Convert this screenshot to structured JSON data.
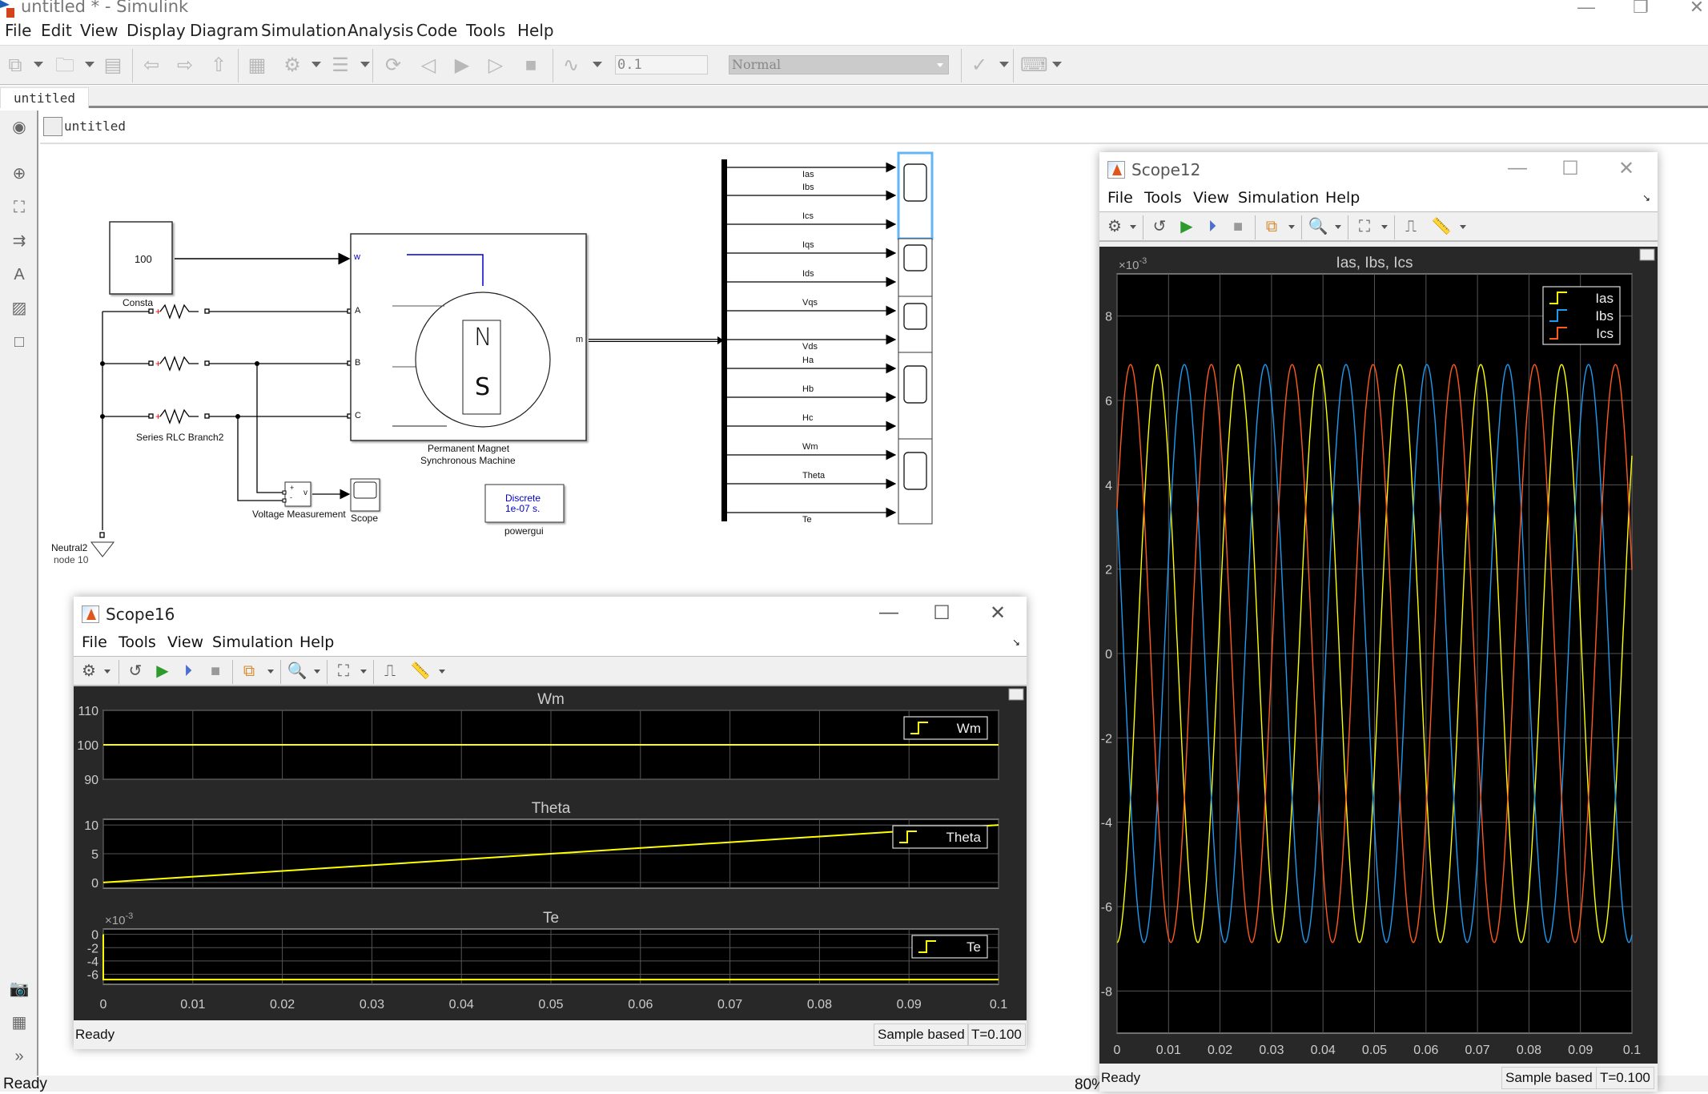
{
  "window": {
    "title": "untitled * - Simulink",
    "minimize_icon": "minimize-icon",
    "restore_icon": "restore-icon",
    "close_icon": "close-icon"
  },
  "menubar": {
    "items": [
      "File",
      "Edit",
      "View",
      "Display",
      "Diagram",
      "Simulation",
      "Analysis",
      "Code",
      "Tools",
      "Help"
    ]
  },
  "toolbar": {
    "stop_time": "0.1",
    "sim_mode": "Normal",
    "icons": [
      "new-model-icon",
      "open-icon",
      "save-icon",
      "back-icon",
      "forward-icon",
      "up-icon",
      "library-browser-icon",
      "model-config-icon",
      "model-explorer-icon",
      "record-icon",
      "step-back-icon",
      "run-icon",
      "step-forward-icon",
      "stop-icon",
      "data-inspector-icon",
      "model-advisor-icon",
      "build-icon"
    ]
  },
  "tabs": [
    {
      "label": "untitled"
    }
  ],
  "breadcrumb": {
    "label": "untitled"
  },
  "palette": {
    "icons": [
      "back-icon",
      "zoom-icon",
      "fit-view-icon",
      "signal-routing-icon",
      "annotation-icon",
      "image-icon",
      "area-icon",
      "screenshot-icon",
      "model-browser-icon",
      "expand-icon"
    ]
  },
  "diagram": {
    "constant": {
      "value": "100",
      "label": "Consta"
    },
    "rlc_label": "Series RLC Branch2",
    "machine": {
      "label_line1": "Permanent Magnet",
      "label_line2": "Synchronous Machine",
      "ports_in": [
        "w",
        "A",
        "B",
        "C"
      ],
      "port_out": "m",
      "pole_n": "N",
      "pole_s": "S"
    },
    "voltage_measurement": {
      "label": "Voltage Measurement",
      "plus": "+",
      "minus": "-",
      "out": "v"
    },
    "scope_label": "Scope",
    "powergui": {
      "line1": "Discrete",
      "line2": "1e-07 s.",
      "label": "powergui"
    },
    "neutral": {
      "label": "Neutral2",
      "sublabel": "node 10"
    },
    "bus_signals": [
      "Ias",
      "Ibs",
      "Ics",
      "Iqs",
      "Ids",
      "Vqs",
      "Vds",
      "Ha",
      "Hb",
      "Hc",
      "Wm",
      "Theta",
      "Te"
    ]
  },
  "status": {
    "left": "Ready",
    "zoom": "80%"
  },
  "scope16": {
    "title": "Scope16",
    "menu": [
      "File",
      "Tools",
      "View",
      "Simulation",
      "Help"
    ],
    "status": {
      "ready": "Ready",
      "mode": "Sample based",
      "time": "T=0.100"
    }
  },
  "scope12": {
    "title": "Scope12",
    "menu": [
      "File",
      "Tools",
      "View",
      "Simulation",
      "Help"
    ],
    "status": {
      "ready": "Ready",
      "mode": "Sample based",
      "time": "T=0.100"
    }
  },
  "colors": {
    "yellow": "#ffff00",
    "blue": "#1e9bf0",
    "orange": "#ff5a1e",
    "plot_bg": "#000000",
    "frame_bg": "#282828"
  },
  "chart_data": [
    {
      "type": "line",
      "title": "Wm",
      "xlabel": "",
      "ylabel": "",
      "xlim": [
        0,
        0.1
      ],
      "ylim": [
        90,
        110
      ],
      "xticks": [
        "0",
        "0.01",
        "0.02",
        "0.03",
        "0.04",
        "0.05",
        "0.06",
        "0.07",
        "0.08",
        "0.09",
        "0.1"
      ],
      "yticks": [
        "90",
        "100",
        "110"
      ],
      "grid": true,
      "legend": "top-right",
      "series": [
        {
          "name": "Wm",
          "color": "#ffff00",
          "x": [
            0,
            0.1
          ],
          "values": [
            100,
            100
          ]
        }
      ]
    },
    {
      "type": "line",
      "title": "Theta",
      "xlim": [
        0,
        0.1
      ],
      "ylim": [
        -1,
        11
      ],
      "yticks": [
        "0",
        "5",
        "10"
      ],
      "grid": true,
      "legend": "top-right",
      "series": [
        {
          "name": "Theta",
          "color": "#ffff00",
          "x": [
            0,
            0.1
          ],
          "values": [
            0,
            10
          ]
        }
      ]
    },
    {
      "type": "line",
      "title": "Te",
      "exponent": "×10^-3",
      "xlim": [
        0,
        0.1
      ],
      "ylim": [
        -7.5,
        0.8
      ],
      "xticks": [
        "0",
        "0.01",
        "0.02",
        "0.03",
        "0.04",
        "0.05",
        "0.06",
        "0.07",
        "0.08",
        "0.09",
        "0.1"
      ],
      "yticks": [
        "0",
        "-2",
        "-4",
        "-6"
      ],
      "grid": true,
      "legend": "top-right",
      "series": [
        {
          "name": "Te",
          "color": "#ffff00",
          "x": [
            0,
            0,
            0.1
          ],
          "values": [
            0,
            -6.8,
            -6.8
          ]
        }
      ]
    },
    {
      "type": "line",
      "title": "Ias, Ibs, Ics",
      "exponent": "×10^-3",
      "xlim": [
        0,
        0.1
      ],
      "ylim": [
        -9,
        9
      ],
      "xticks": [
        "0",
        "0.01",
        "0.02",
        "0.03",
        "0.04",
        "0.05",
        "0.06",
        "0.07",
        "0.08",
        "0.09",
        "0.1"
      ],
      "yticks": [
        "-8",
        "-6",
        "-4",
        "-2",
        "0",
        "2",
        "4",
        "6",
        "8"
      ],
      "grid": true,
      "legend": "top-right",
      "waveform": {
        "amplitude": 6.85,
        "frequency_hz": 63.7,
        "phase_deg_ias": 180
      },
      "series": [
        {
          "name": "Ias",
          "color": "#ffff00",
          "phase_deg": 180
        },
        {
          "name": "Ibs",
          "color": "#1e9bf0",
          "phase_deg": 60
        },
        {
          "name": "Ics",
          "color": "#ff5a1e",
          "phase_deg": 300
        }
      ]
    }
  ]
}
